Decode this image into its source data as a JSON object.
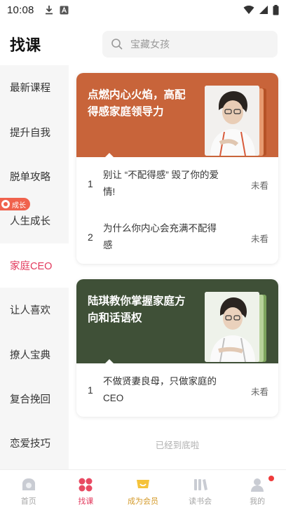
{
  "status_bar": {
    "time": "10:08"
  },
  "header": {
    "title": "找课",
    "search_placeholder": "宝藏女孩"
  },
  "sidebar": {
    "active_color": "#e23a5d",
    "items": [
      {
        "label": "最新课程"
      },
      {
        "label": "提升自我"
      },
      {
        "label": "脱单攻略"
      },
      {
        "label": "人生成长",
        "badge": "成长"
      },
      {
        "label": "家庭CEO",
        "active": true
      },
      {
        "label": "让人喜欢"
      },
      {
        "label": "撩人宝典"
      },
      {
        "label": "复合挽回"
      },
      {
        "label": "恋爱技巧"
      }
    ]
  },
  "courses": [
    {
      "title": "点燃内心火焰，高配得感家庭领导力",
      "banner_color": "#c8643a",
      "lessons": [
        {
          "num": "1",
          "title": "别让 “不配得感” 毁了你的爱情!",
          "status": "未看"
        },
        {
          "num": "2",
          "title": "为什么你内心会充满不配得感",
          "status": "未看"
        }
      ]
    },
    {
      "title": "陆琪教你掌握家庭方向和话语权",
      "banner_color": "#3f5037",
      "lessons": [
        {
          "num": "1",
          "title": "不做贤妻良母，只做家庭的CEO",
          "status": "未看"
        }
      ]
    }
  ],
  "footer_note": "已经到底啦",
  "tabbar": {
    "tabs": [
      {
        "label": "首页",
        "icon": "home-icon"
      },
      {
        "label": "找课",
        "icon": "grid-icon",
        "active": true
      },
      {
        "label": "成为会员",
        "icon": "smile-crown-icon"
      },
      {
        "label": "读书会",
        "icon": "books-icon"
      },
      {
        "label": "我的",
        "icon": "profile-icon"
      }
    ]
  }
}
